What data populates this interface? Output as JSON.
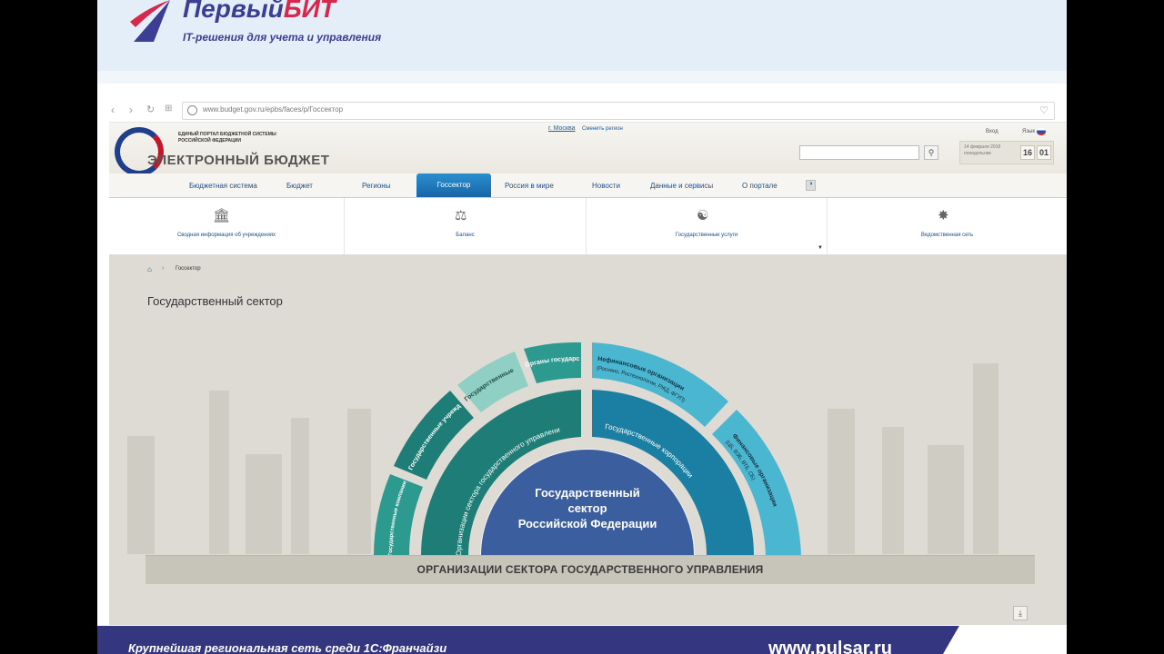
{
  "slide": {
    "brand": {
      "name_part1": "Первый",
      "name_part2": "БИТ",
      "tagline": "IT-решения для учета и управления"
    },
    "footer_left": "Крупнейшая региональная сеть среди 1С:Франчайзи",
    "footer_right": "www.pulsar.ru"
  },
  "browser": {
    "url": "www.budget.gov.ru/epbs/faces/p/Госсектор",
    "nav_icons": [
      "back-icon",
      "forward-icon",
      "reload-icon",
      "apps-icon"
    ]
  },
  "portal": {
    "small_title": "ЕДИНЫЙ ПОРТАЛ БЮДЖЕТНОЙ СИСТЕМЫ РОССИЙСКОЙ ФЕДЕРАЦИИ",
    "big_title": "ЭЛЕКТРОННЫЙ БЮДЖЕТ",
    "region": "г. Москва",
    "region_change": "Сменить регион",
    "login": "Вход",
    "lang": "Язык",
    "date": "14 февраля 2018 понедельник",
    "time_h": "16",
    "time_m": "01"
  },
  "main_nav": {
    "items": [
      "Бюджетная система",
      "Бюджет",
      "Регионы",
      "Госсектор",
      "Россия в мире",
      "Новости",
      "Данные и сервисы",
      "О портале"
    ],
    "active": "Госсектор"
  },
  "sub_nav": {
    "items": [
      {
        "label": "Сводная информация об учреждениях",
        "icon": "building-icon"
      },
      {
        "label": "Баланс",
        "icon": "scales-icon"
      },
      {
        "label": "Государственные услуги",
        "icon": "service-icon"
      },
      {
        "label": "Ведомственная сеть",
        "icon": "network-icon"
      }
    ]
  },
  "content": {
    "breadcrumb": "Госсектор",
    "title": "Государственный сектор",
    "center_label": [
      "Государственный",
      "сектор",
      "Российской Федерации"
    ],
    "middle_left": "Организации сектора государственного управления",
    "middle_right": "Государственные корпорации",
    "outer_segments": [
      {
        "label": "Государственные компании в ЕГУ"
      },
      {
        "label": "Государственные учреждения"
      },
      {
        "label": "Государственные органы"
      },
      {
        "label": "Органы государственной власти"
      },
      {
        "label": "Нефинансовые организации",
        "sub": "(Роснано, Ростехнологии, РЖД, ФГУП)"
      },
      {
        "label": "Финансовые организации",
        "sub": "(ЦБ, ВЭБ, ВТБ, СБ)"
      }
    ],
    "footer_bar": "ОРГАНИЗАЦИИ СЕКТОРА ГОСУДАРСТВЕННОГО УПРАВЛЕНИЯ",
    "colors": {
      "teal_dark": "#1e7e77",
      "teal_mid": "#2d9a90",
      "teal_light": "#8fcfc4",
      "blue_dark": "#1b7fa3",
      "blue_light": "#4ab6d0",
      "center": "#3b5f9e"
    }
  }
}
